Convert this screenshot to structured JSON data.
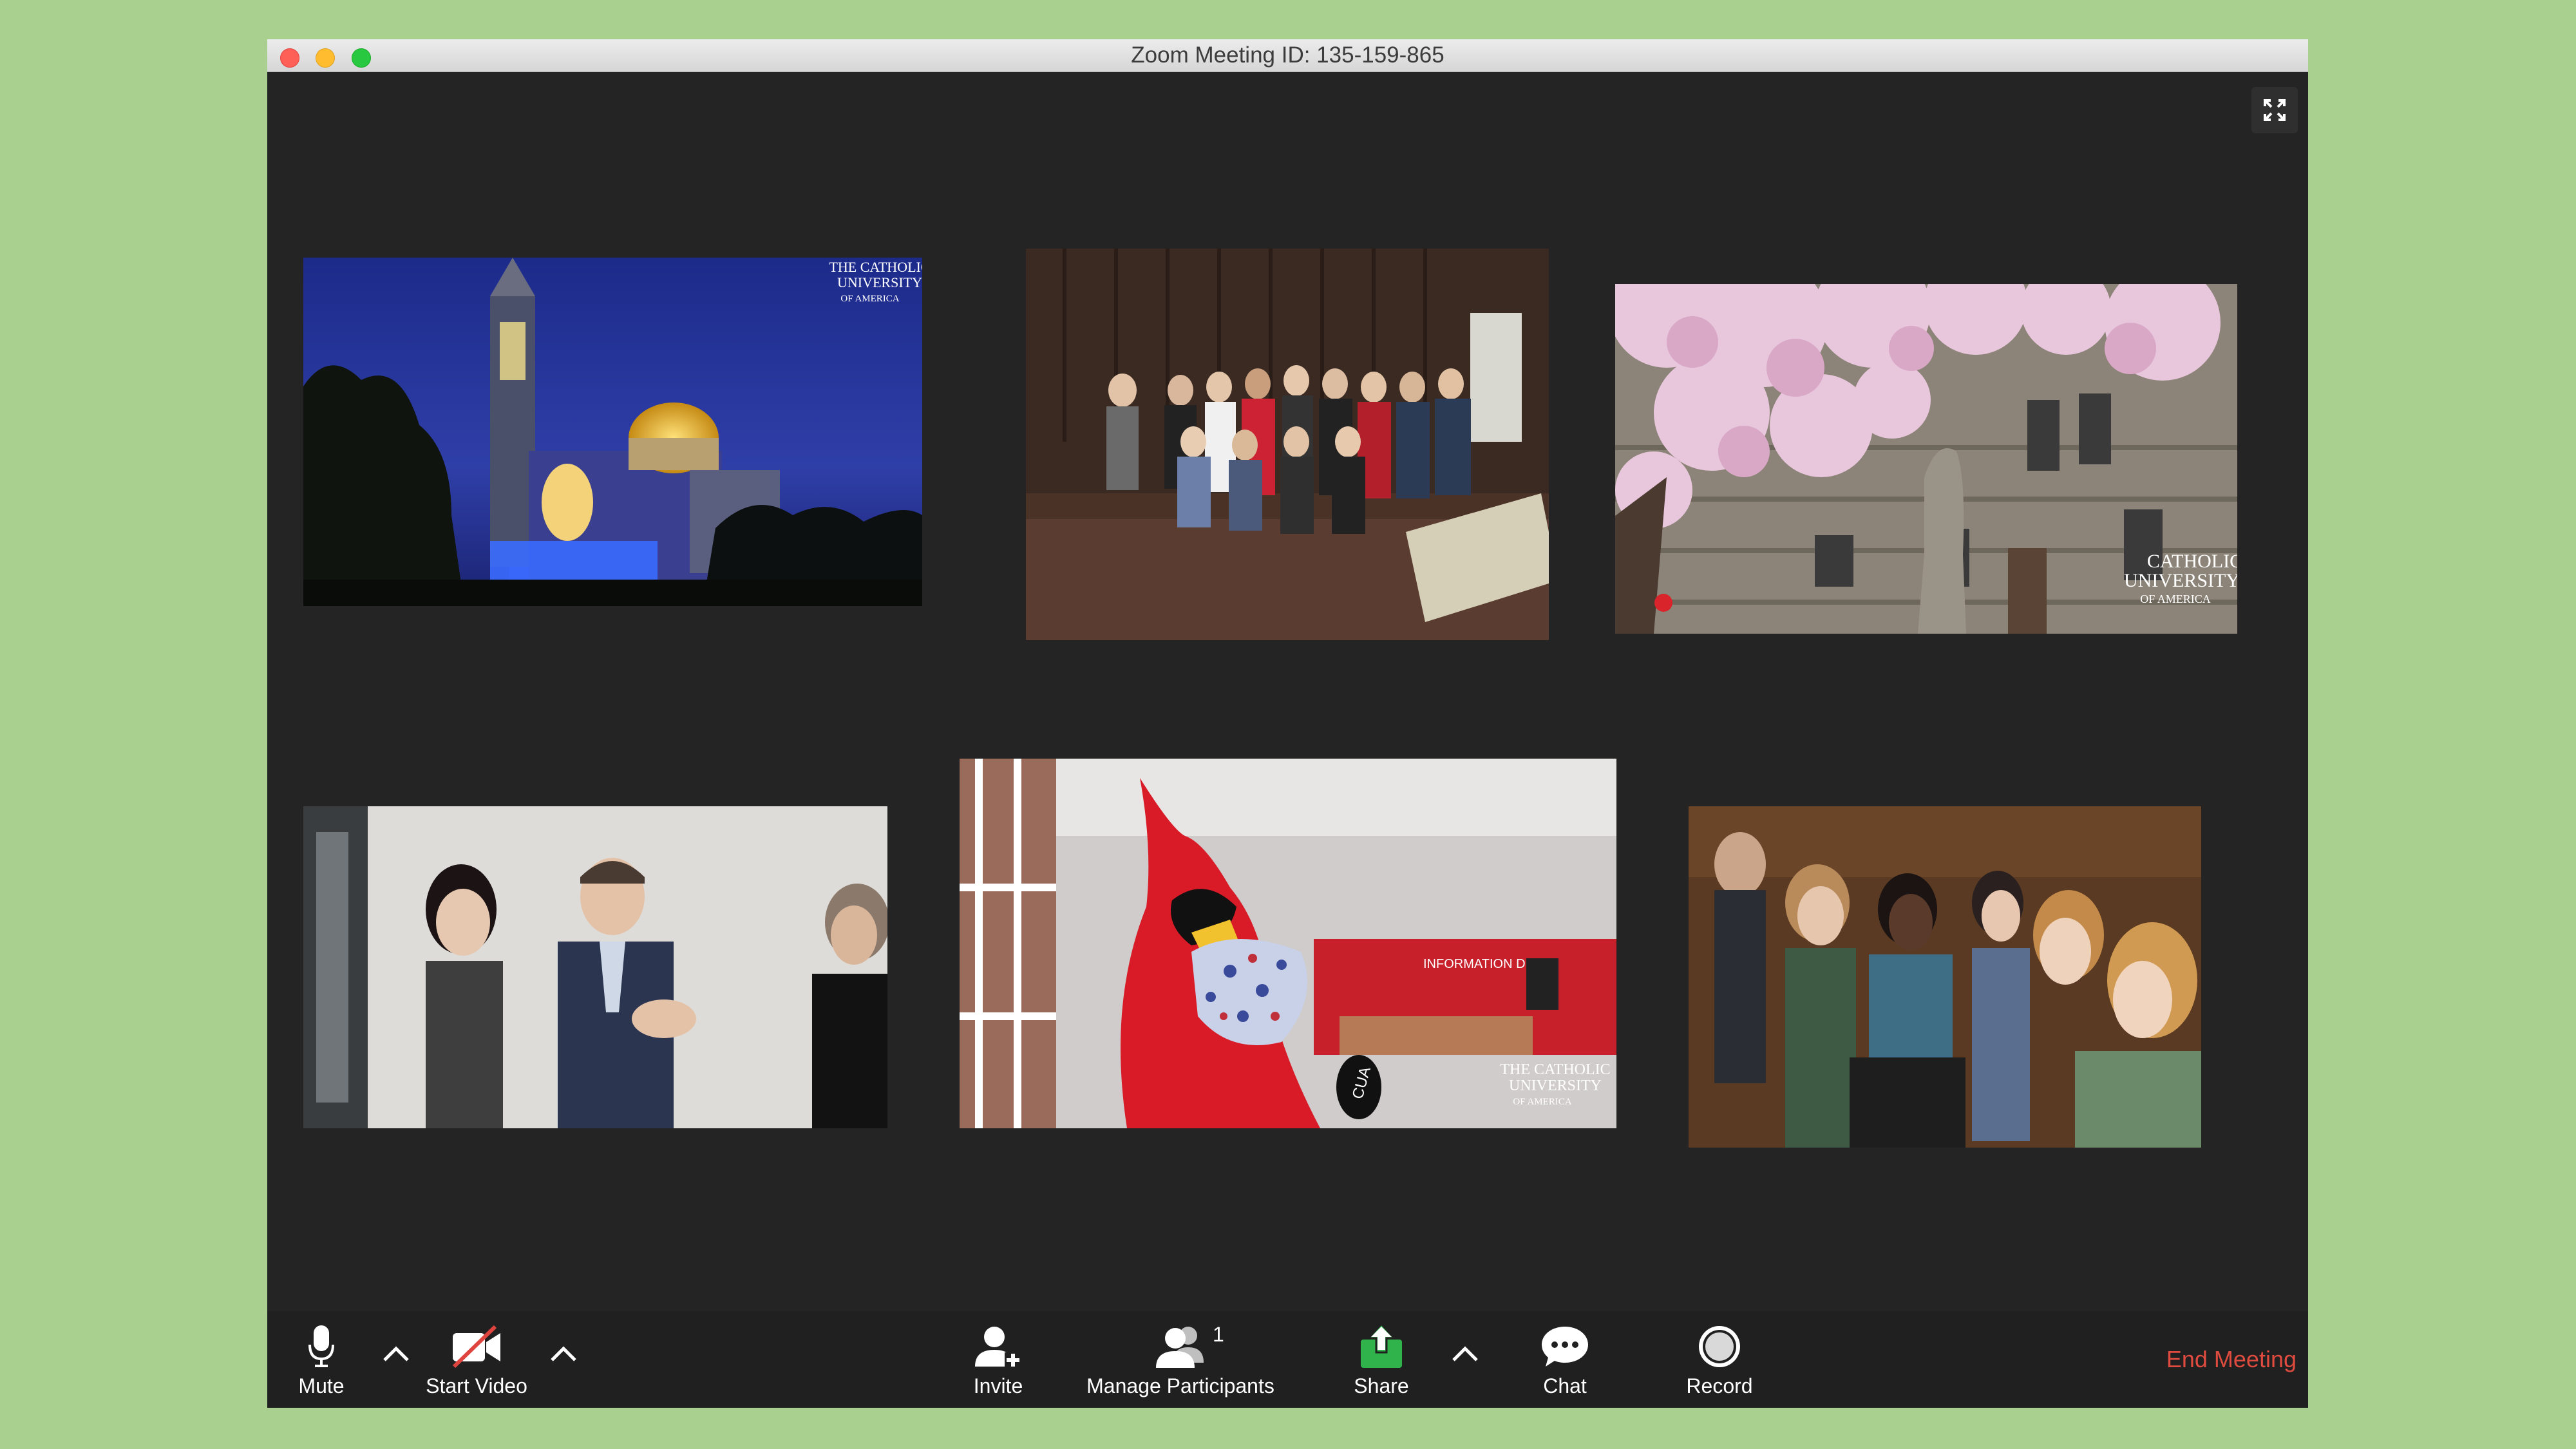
{
  "window": {
    "title": "Zoom Meeting ID: 135-159-865"
  },
  "tiles": [
    {
      "name": "basilica-night-photo",
      "watermark": [
        "THE CATHOLIC",
        "UNIVERSITY",
        "OF AMERICA"
      ]
    },
    {
      "name": "group-photo-library"
    },
    {
      "name": "cherry-blossom-building-photo",
      "watermark": [
        "CATHOLIC",
        "UNIVERSITY",
        "OF AMERICA"
      ]
    },
    {
      "name": "people-clapping-photo"
    },
    {
      "name": "cardinal-mascot-masked-photo",
      "watermark": [
        "THE CATHOLIC",
        "UNIVERSITY",
        "OF AMERICA"
      ],
      "sign_text": "INFORMATION DESK",
      "glove_text": "CUA"
    },
    {
      "name": "students-audience-photo"
    }
  ],
  "toolbar": {
    "mute_label": "Mute",
    "start_video_label": "Start Video",
    "invite_label": "Invite",
    "manage_participants_label": "Manage Participants",
    "participant_count": "1",
    "share_label": "Share",
    "chat_label": "Chat",
    "record_label": "Record",
    "end_meeting_label": "End Meeting"
  },
  "colors": {
    "background": "#a9d08e",
    "window_bg": "#242424",
    "share_green": "#2fb34a",
    "end_meeting_red": "#e04b3f",
    "video_off_red": "#e0443e"
  },
  "icons": [
    "microphone-icon",
    "video-camera-off-icon",
    "caret-up-icon",
    "add-user-icon",
    "participants-icon",
    "share-screen-icon",
    "chat-bubble-icon",
    "record-icon",
    "fullscreen-icon"
  ]
}
